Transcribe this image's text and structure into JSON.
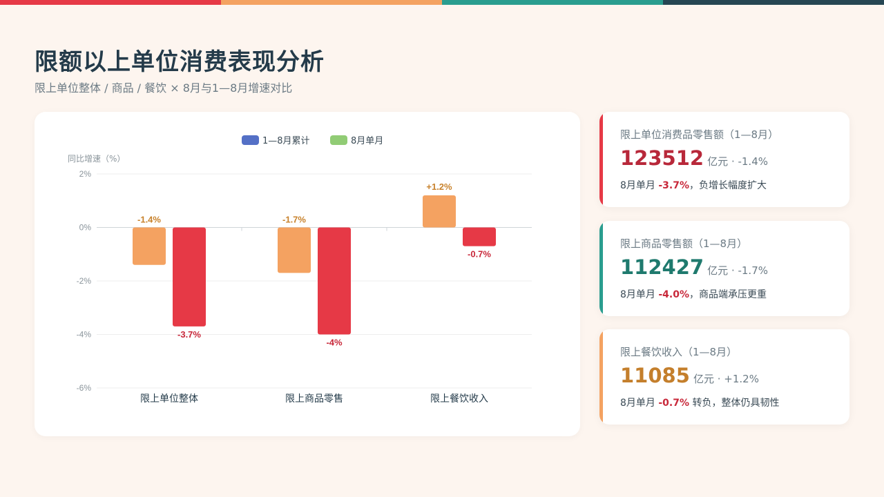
{
  "colors": {
    "stripe": [
      "#e63946",
      "#f4a261",
      "#2a9d8f",
      "#264653"
    ],
    "cumulative_bar": "#f4a261",
    "monthly_bar": "#e63946",
    "legend_cumulative": "#5470c6",
    "legend_monthly": "#91cc75",
    "label_cumulative": "#c8822c",
    "label_monthly": "#c8283a"
  },
  "header": {
    "title": "限额以上单位消费表现分析",
    "subtitle": "限上单位整体 / 商品 / 餐饮 × 8月与1—8月增速对比"
  },
  "chart_data": {
    "type": "bar",
    "categories": [
      "限上单位整体",
      "限上商品零售",
      "限上餐饮收入"
    ],
    "series": [
      {
        "name": "1—8月累计",
        "values": [
          -1.4,
          -1.7,
          1.2
        ],
        "labels": [
          "-1.4%",
          "-1.7%",
          "+1.2%"
        ]
      },
      {
        "name": "8月单月",
        "values": [
          -3.7,
          -4.0,
          -0.7
        ],
        "labels": [
          "-3.7%",
          "-4%",
          "-0.7%"
        ]
      }
    ],
    "ylabel": "同比增速（%）",
    "ylim": [
      -6,
      2
    ],
    "yticks": [
      2,
      0,
      -2,
      -4,
      -6
    ],
    "ytick_labels": [
      "2%",
      "0%",
      "-2%",
      "-4%",
      "-6%"
    ],
    "legend_position": "top-center",
    "grid": true
  },
  "cards": [
    {
      "title": "限上单位消费品零售额（1—8月）",
      "value": "123512",
      "unit": "亿元 · -1.4%",
      "note_prefix": "8月单月 ",
      "note_highlight": "-3.7%",
      "note_suffix": "，负增长幅度扩大",
      "color": "#b8283a"
    },
    {
      "title": "限上商品零售额（1—8月）",
      "value": "112427",
      "unit": "亿元 · -1.7%",
      "note_prefix": "8月单月 ",
      "note_highlight": "-4.0%",
      "note_suffix": "，商品端承压更重",
      "color": "#1f7a6e"
    },
    {
      "title": "限上餐饮收入（1—8月）",
      "value": "11085",
      "unit": "亿元 · +1.2%",
      "note_prefix": "8月单月 ",
      "note_highlight": "-0.7%",
      "note_suffix": " 转负，整体仍具韧性",
      "color": "#c47f2c"
    }
  ]
}
